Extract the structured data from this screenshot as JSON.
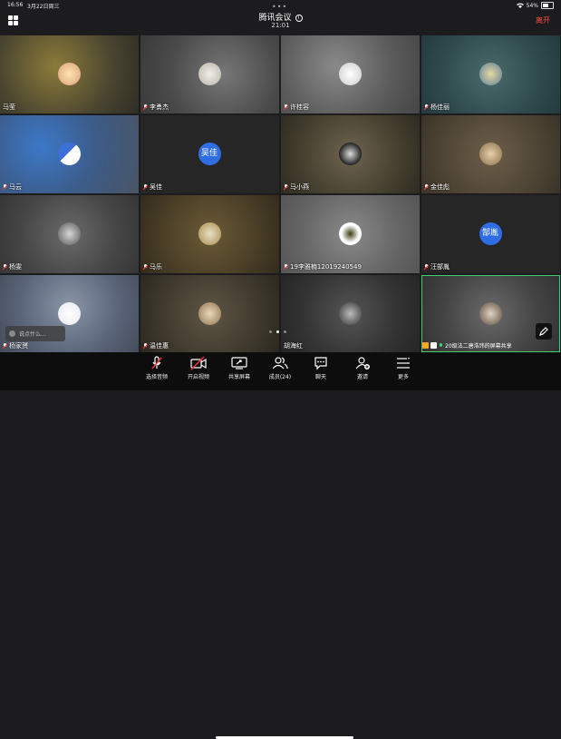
{
  "status": {
    "time": "16:56",
    "date": "3月22日周三",
    "battery": "54%"
  },
  "header": {
    "title": "腾讯会议",
    "time": "21:01",
    "leave_label": "离开"
  },
  "tiles": [
    {
      "name": "马莹",
      "mic": "none"
    },
    {
      "name": "李勇杰",
      "mic": "muted"
    },
    {
      "name": "许桂容",
      "mic": "muted"
    },
    {
      "name": "杨佳丽",
      "mic": "muted"
    },
    {
      "name": "马云",
      "mic": "muted"
    },
    {
      "name": "吴佳",
      "mic": "muted",
      "avatar_text": "吴佳"
    },
    {
      "name": "马小燕",
      "mic": "muted"
    },
    {
      "name": "金佳彪",
      "mic": "muted"
    },
    {
      "name": "杨雯",
      "mic": "muted"
    },
    {
      "name": "马乐",
      "mic": "muted"
    },
    {
      "name": "19李雅楠12019240549",
      "mic": "muted"
    },
    {
      "name": "汪郜胤",
      "mic": "muted",
      "avatar_text": "郜胤"
    },
    {
      "name": "杨家赟",
      "mic": "muted"
    },
    {
      "name": "温佳惠",
      "mic": "muted"
    },
    {
      "name": "胡海红",
      "mic": "none"
    },
    {
      "name": "20级法二唐浩玮的屏幕共享",
      "mic": "on"
    }
  ],
  "chat_placeholder": "说点什么...",
  "toolbar": {
    "mute": "选择音频",
    "video": "开启视频",
    "share": "共享屏幕",
    "members": "成员(24)",
    "chat": "聊天",
    "invite": "邀请",
    "more": "更多"
  },
  "colors": {
    "leave": "#ff4d3d",
    "avatar_blue": "#2f6de2",
    "active_border": "#3bd16f"
  }
}
